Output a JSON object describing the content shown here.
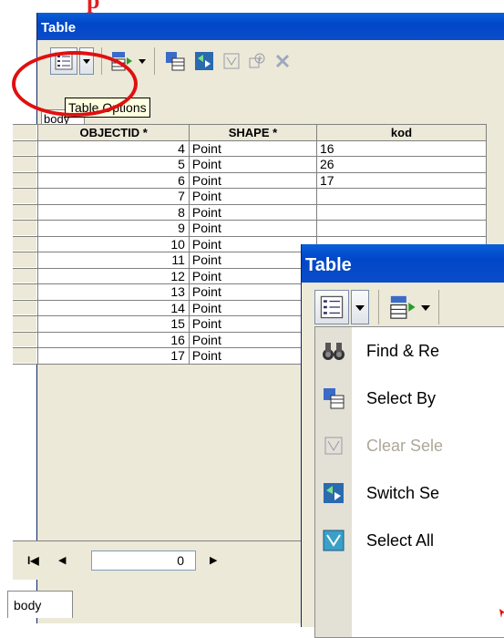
{
  "annotation_text": "p",
  "back_window": {
    "title": "Table",
    "tooltip": "Table Options",
    "tab_label": "body",
    "columns": [
      "",
      "OBJECTID *",
      "SHAPE *",
      "kod"
    ],
    "rows": [
      {
        "objectid": "4",
        "shape": "Point",
        "kod": "16"
      },
      {
        "objectid": "5",
        "shape": "Point",
        "kod": "26"
      },
      {
        "objectid": "6",
        "shape": "Point",
        "kod": "17"
      },
      {
        "objectid": "7",
        "shape": "Point",
        "kod": ""
      },
      {
        "objectid": "8",
        "shape": "Point",
        "kod": ""
      },
      {
        "objectid": "9",
        "shape": "Point",
        "kod": ""
      },
      {
        "objectid": "10",
        "shape": "Point",
        "kod": ""
      },
      {
        "objectid": "11",
        "shape": "Point",
        "kod": ""
      },
      {
        "objectid": "12",
        "shape": "Point",
        "kod": ""
      },
      {
        "objectid": "13",
        "shape": "Point",
        "kod": ""
      },
      {
        "objectid": "14",
        "shape": "Point",
        "kod": ""
      },
      {
        "objectid": "15",
        "shape": "Point",
        "kod": ""
      },
      {
        "objectid": "16",
        "shape": "Point",
        "kod": ""
      },
      {
        "objectid": "17",
        "shape": "Point",
        "kod": ""
      }
    ],
    "nav": {
      "first": "I◀",
      "prev": "◀",
      "record": "0",
      "next": "▶"
    },
    "bottom_tab": "body"
  },
  "front_window": {
    "title": "Table",
    "menu_items": [
      {
        "label": "Find & Re",
        "icon": "binoculars-icon",
        "disabled": false
      },
      {
        "label": "Select By",
        "icon": "select-by-attributes-icon",
        "disabled": false
      },
      {
        "label": "Clear Sele",
        "icon": "clear-selection-icon",
        "disabled": true
      },
      {
        "label": "Switch Se",
        "icon": "switch-selection-icon",
        "disabled": false
      },
      {
        "label": "Select All",
        "icon": "select-all-icon",
        "disabled": false
      }
    ]
  },
  "colors": {
    "title_bar": "#0047c8",
    "highlight_circle": "#e01010",
    "annotation": "#e02020"
  }
}
